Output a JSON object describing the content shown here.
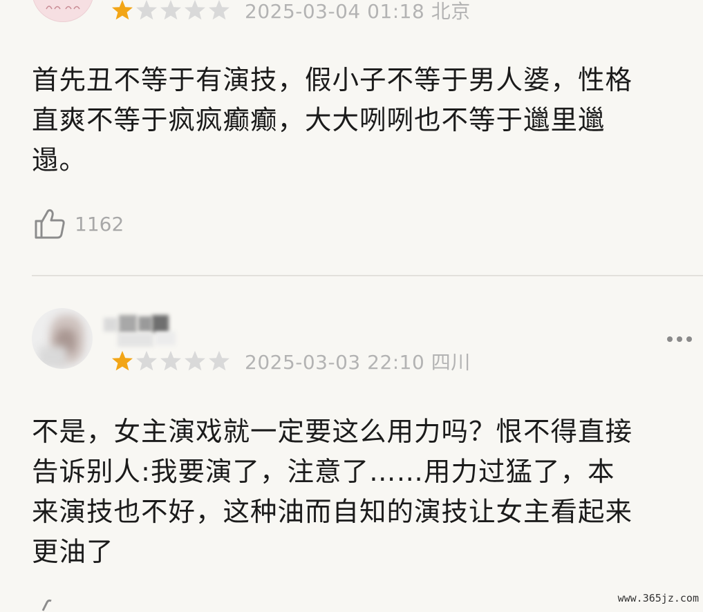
{
  "comments": [
    {
      "rating": 1,
      "max_rating": 5,
      "date": "2025-03-04 01:18",
      "location": "北京",
      "meta": "2025-03-04 01:18 北京",
      "text": "首先丑不等于有演技，假小子不等于男人婆，性格\n直爽不等于疯疯癫癫，大大咧咧也不等于邋里邋\n遢。",
      "likes": "1162"
    },
    {
      "rating": 1,
      "max_rating": 5,
      "date": "2025-03-03 22:10",
      "location": "四川",
      "meta": "2025-03-03 22:10 四川",
      "text": "不是，女主演戏就一定要这么用力吗？恨不得直接\n告诉别人:我要演了，注意了……用力过猛了，本\n来演技也不好，这种油而自知的演技让女主看起来\n更油了"
    }
  ],
  "watermark": "www.365jz.com",
  "colors": {
    "background": "#f8f7f3",
    "star_filled": "#f2a516",
    "star_empty": "#d9d9d9",
    "meta_text": "#b3b3b3",
    "divider": "#e2e0db"
  },
  "icons": {
    "like": "thumbs-up-icon",
    "more": "more-dots-icon",
    "star": "star-icon"
  }
}
